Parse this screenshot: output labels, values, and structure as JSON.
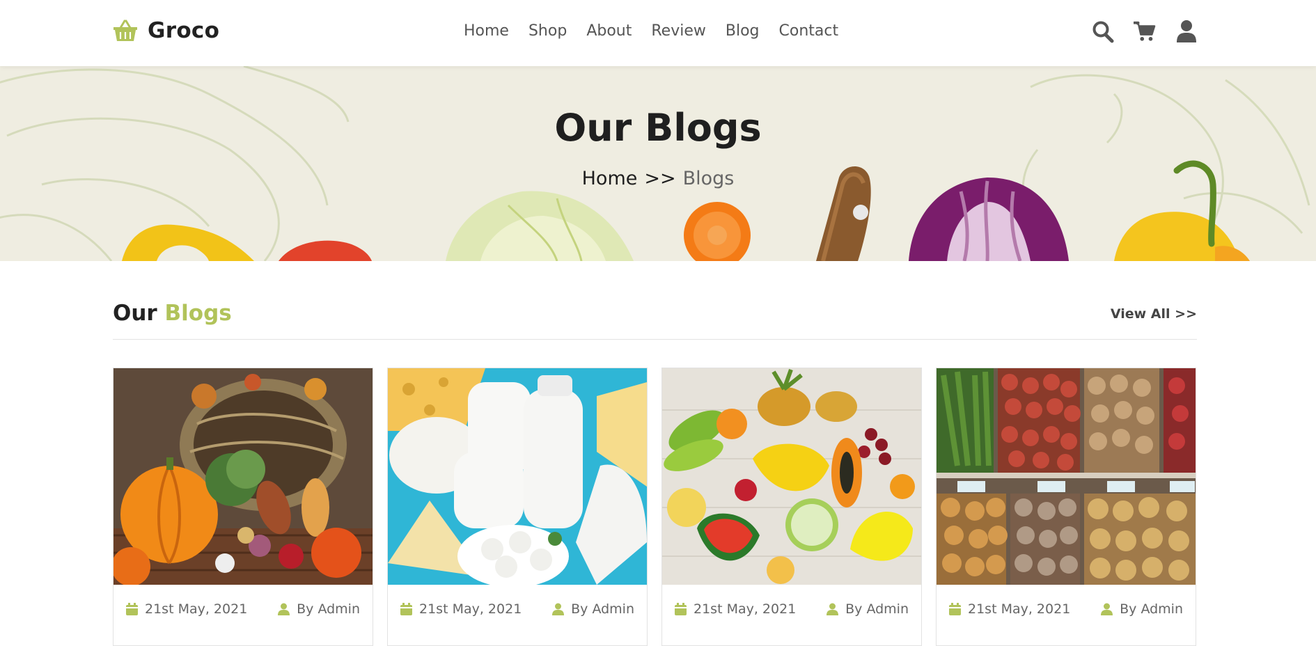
{
  "brand": {
    "name": "Groco",
    "accent": "#b1c35a"
  },
  "nav": [
    "Home",
    "Shop",
    "About",
    "Review",
    "Blog",
    "Contact"
  ],
  "header_icons": [
    "search-icon",
    "cart-icon",
    "user-icon"
  ],
  "banner": {
    "title": "Our Blogs",
    "breadcrumb_home": "Home",
    "breadcrumb_sep": ">>",
    "breadcrumb_current": "Blogs"
  },
  "section": {
    "title_main": "Our",
    "title_accent": "Blogs",
    "view_all": "View All >>"
  },
  "cards": [
    {
      "image": "vegetable-basket-image",
      "date": "21st May, 2021",
      "author": "By Admin"
    },
    {
      "image": "dairy-products-image",
      "date": "21st May, 2021",
      "author": "By Admin"
    },
    {
      "image": "fresh-fruits-image",
      "date": "21st May, 2021",
      "author": "By Admin"
    },
    {
      "image": "market-produce-image",
      "date": "21st May, 2021",
      "author": "By Admin"
    }
  ]
}
